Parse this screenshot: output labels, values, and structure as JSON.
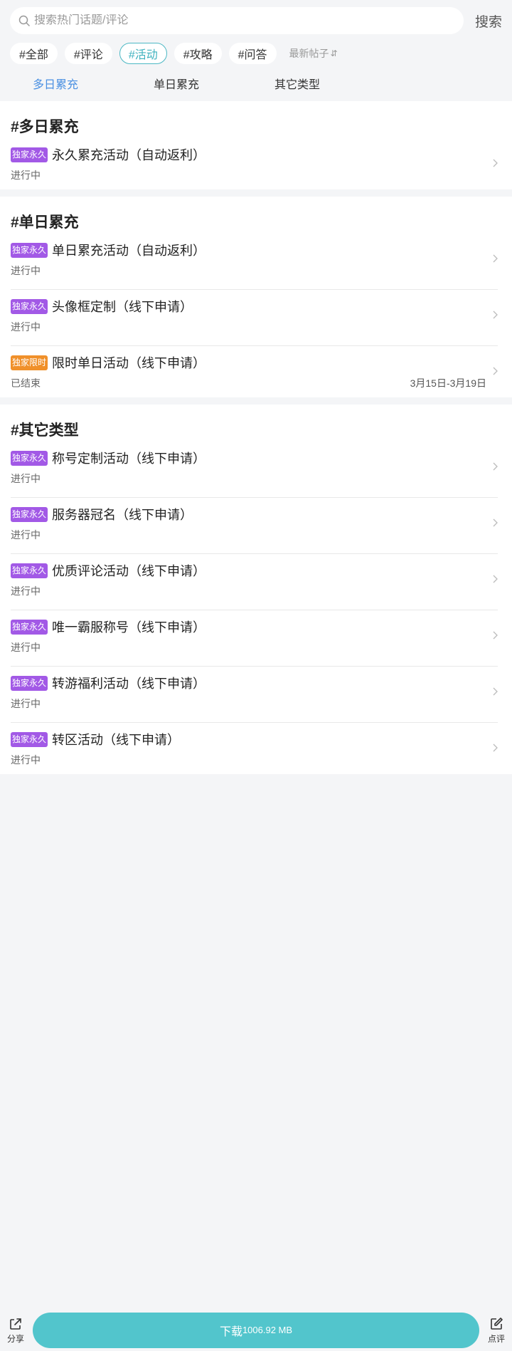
{
  "search": {
    "placeholder": "搜索热门话题/评论",
    "button": "搜索"
  },
  "tags": [
    {
      "label": "#全部",
      "active": false
    },
    {
      "label": "#评论",
      "active": false
    },
    {
      "label": "#活动",
      "active": true
    },
    {
      "label": "#攻略",
      "active": false
    },
    {
      "label": "#问答",
      "active": false
    }
  ],
  "sort": {
    "label": "最新帖子",
    "icon": "sort-arrows-icon"
  },
  "subtabs": [
    {
      "label": "多日累充",
      "active": true
    },
    {
      "label": "单日累充",
      "active": false
    },
    {
      "label": "其它类型",
      "active": false
    }
  ],
  "colors": {
    "accent": "#4cb8c4",
    "tab_active": "#4a90e2",
    "badge_permanent": "#a259e6",
    "badge_limited": "#f0902a",
    "download": "#52c5cc"
  },
  "sections": [
    {
      "title": "#多日累充",
      "items": [
        {
          "badge": "独家永久",
          "badge_type": "permanent",
          "title": "永久累充活动（自动返利）",
          "status": "进行中",
          "date": ""
        }
      ]
    },
    {
      "title": "#单日累充",
      "items": [
        {
          "badge": "独家永久",
          "badge_type": "permanent",
          "title": "单日累充活动（自动返利）",
          "status": "进行中",
          "date": ""
        },
        {
          "badge": "独家永久",
          "badge_type": "permanent",
          "title": "头像框定制（线下申请）",
          "status": "进行中",
          "date": ""
        },
        {
          "badge": "独家限时",
          "badge_type": "limited",
          "title": "限时单日活动（线下申请）",
          "status": "已结束",
          "date": "3月15日-3月19日"
        }
      ]
    },
    {
      "title": "#其它类型",
      "items": [
        {
          "badge": "独家永久",
          "badge_type": "permanent",
          "title": "称号定制活动（线下申请）",
          "status": "进行中",
          "date": ""
        },
        {
          "badge": "独家永久",
          "badge_type": "permanent",
          "title": "服务器冠名（线下申请）",
          "status": "进行中",
          "date": ""
        },
        {
          "badge": "独家永久",
          "badge_type": "permanent",
          "title": "优质评论活动（线下申请）",
          "status": "进行中",
          "date": ""
        },
        {
          "badge": "独家永久",
          "badge_type": "permanent",
          "title": "唯一霸服称号（线下申请）",
          "status": "进行中",
          "date": ""
        },
        {
          "badge": "独家永久",
          "badge_type": "permanent",
          "title": "转游福利活动（线下申请）",
          "status": "进行中",
          "date": ""
        },
        {
          "badge": "独家永久",
          "badge_type": "permanent",
          "title": "转区活动（线下申请）",
          "status": "进行中",
          "date": ""
        }
      ]
    }
  ],
  "bottom": {
    "share_label": "分享",
    "download_label": "下载",
    "download_size": "1006.92 MB",
    "review_label": "点评"
  }
}
